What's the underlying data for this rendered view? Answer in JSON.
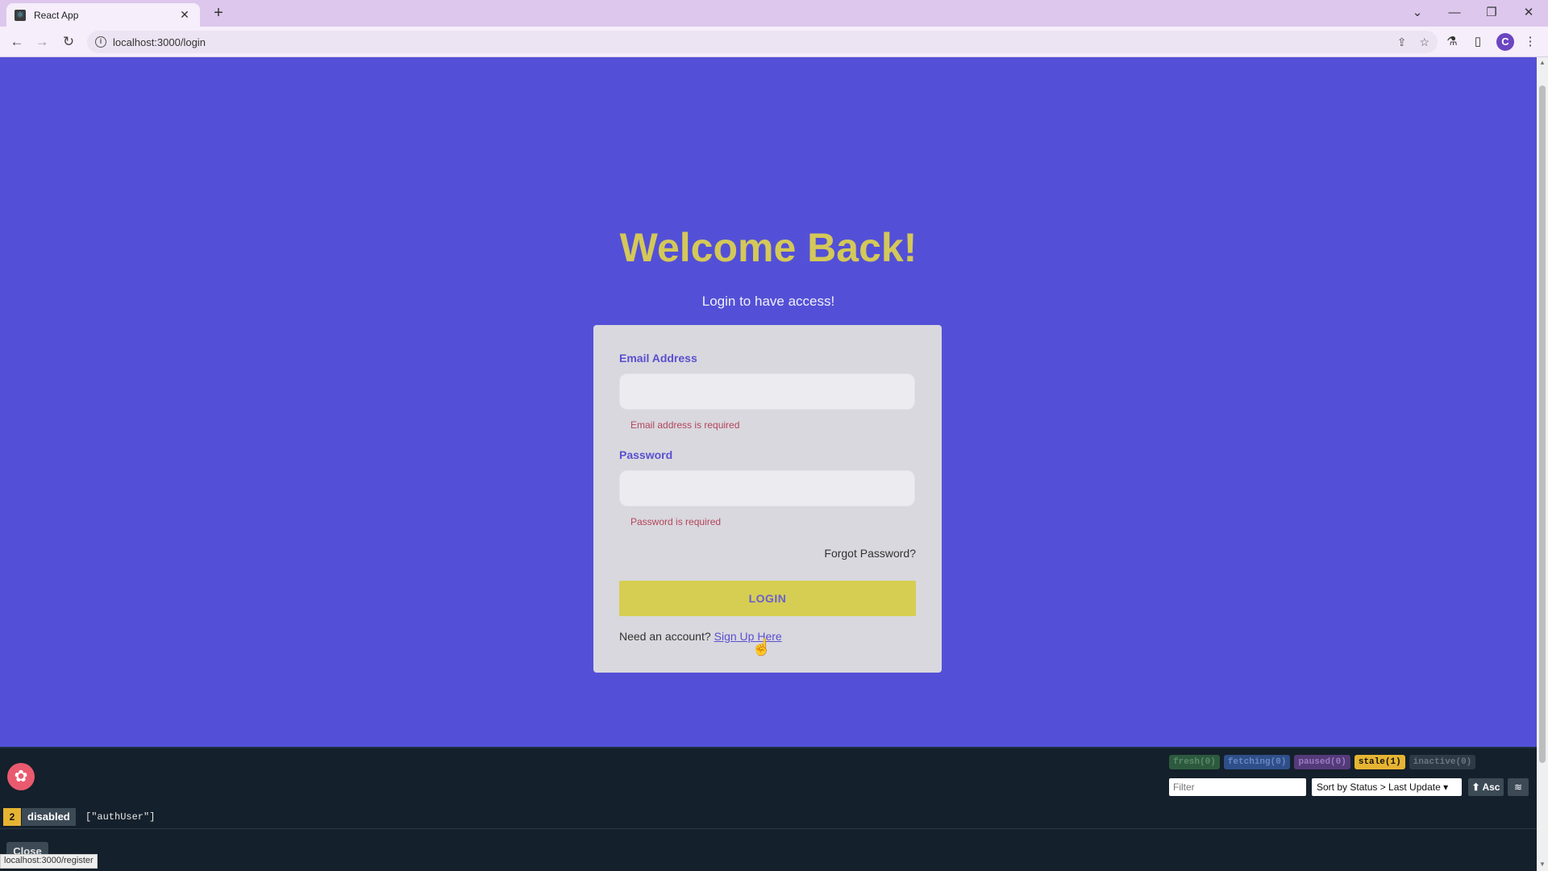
{
  "browser": {
    "tab_title": "React App",
    "tab_favicon": "react-icon",
    "url": "localhost:3000/login",
    "status_url": "localhost:3000/register",
    "profile_initial": "C"
  },
  "page": {
    "headline": "Welcome Back!",
    "subheading": "Login to have access!",
    "email_label": "Email Address",
    "email_value": "",
    "email_error": "Email address is required",
    "password_label": "Password",
    "password_value": "",
    "password_error": "Password is required",
    "forgot_link": "Forgot Password?",
    "login_button": "LOGIN",
    "signup_prompt": "Need an account?",
    "signup_link": "Sign Up Here"
  },
  "devtools": {
    "badges": [
      {
        "label": "fresh(0)",
        "bg": "#2d5a3e",
        "fg": "#5a8a6a"
      },
      {
        "label": "fetching(0)",
        "bg": "#2f4f8a",
        "fg": "#6a88c2"
      },
      {
        "label": "paused(0)",
        "bg": "#553a7a",
        "fg": "#9a7ac2"
      },
      {
        "label": "stale(1)",
        "bg": "#e6b432",
        "fg": "#111111"
      },
      {
        "label": "inactive(0)",
        "bg": "#2e3a46",
        "fg": "#6a7784"
      }
    ],
    "filter_placeholder": "Filter",
    "sort_label": "Sort by Status > Last Update",
    "asc_label": "⬆ Asc",
    "query_count": "2",
    "query_state": "disabled",
    "query_key": "[\"authUser\"]",
    "close_label": "Close"
  },
  "colors": {
    "page_bg": "#5350d7",
    "headline": "#d4c858",
    "accent": "#5a4fd0",
    "error": "#b5445a",
    "button": "#d6ce52"
  }
}
